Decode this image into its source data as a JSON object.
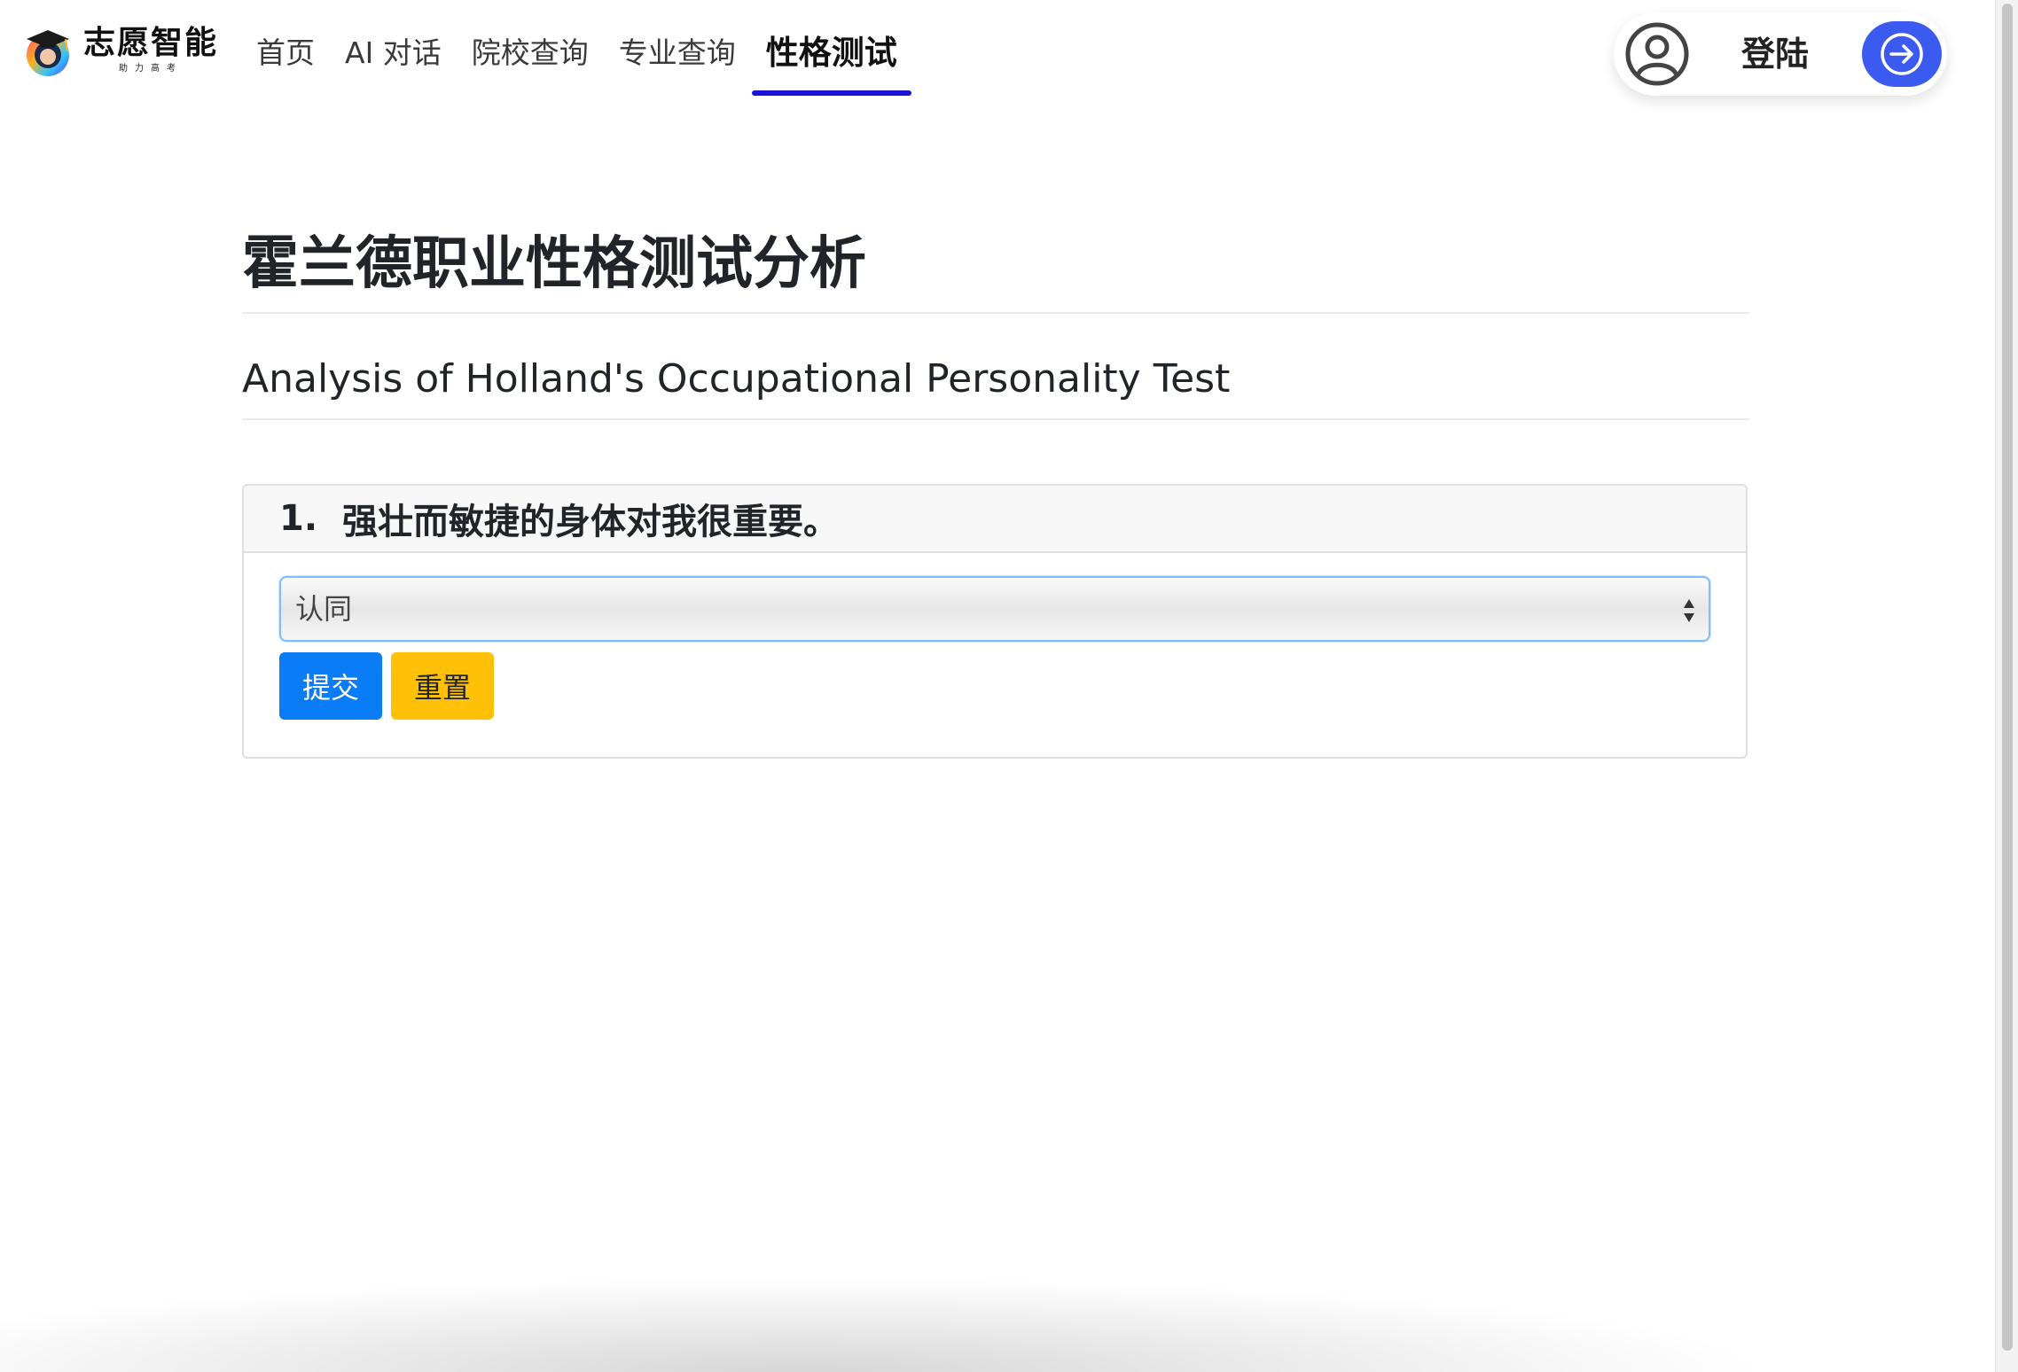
{
  "brand": {
    "name": "志愿智能",
    "tagline": "助力高考"
  },
  "nav": {
    "items": [
      {
        "label": "首页",
        "active": false
      },
      {
        "label": "AI 对话",
        "active": false
      },
      {
        "label": "院校查询",
        "active": false
      },
      {
        "label": "专业查询",
        "active": false
      },
      {
        "label": "性格测试",
        "active": true
      }
    ],
    "active_color": "#1a14d8"
  },
  "auth": {
    "user_icon": "user-circle-icon",
    "login_label": "登陆",
    "login_icon": "arrow-right-circle-icon",
    "button_color": "#3b5bf0"
  },
  "page": {
    "title_cn": "霍兰德职业性格测试分析",
    "title_en": "Analysis of Holland's Occupational Personality Test"
  },
  "question": {
    "number": "1.",
    "text": "强壮而敏捷的身体对我很重要。",
    "selected_answer": "认同",
    "submit_label": "提交",
    "reset_label": "重置",
    "submit_color": "#0a7cf6",
    "reset_color": "#ffc107"
  }
}
